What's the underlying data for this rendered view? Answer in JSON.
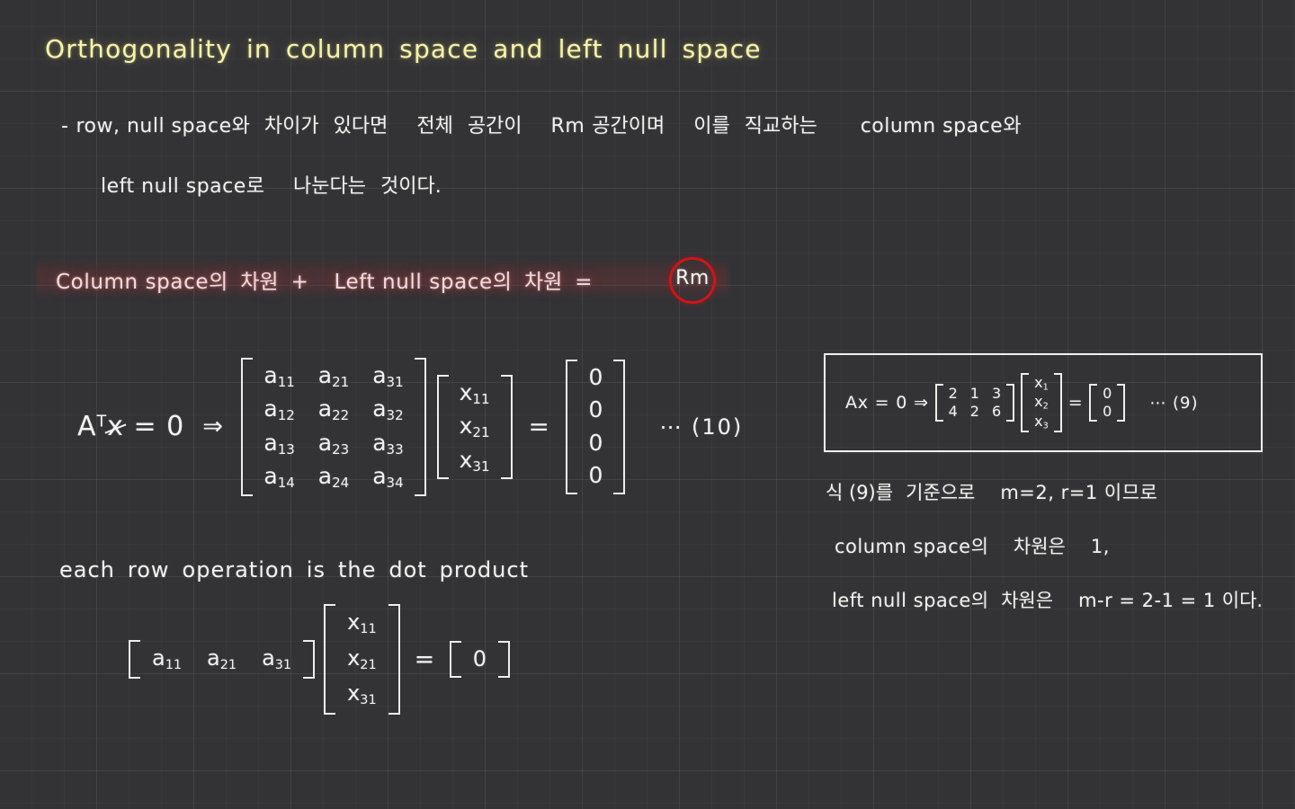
{
  "page": {
    "background_color": "#333336",
    "grid_color": "#3d3d41"
  },
  "title": {
    "words": [
      "Orthogonality",
      "in",
      "column",
      "space",
      "and",
      "left",
      "null",
      "space"
    ],
    "color": "#f7f3a8"
  },
  "paragraph": {
    "line1": {
      "bullet": "-",
      "seg1": "row, null space",
      "seg2": "와",
      "seg3": "차이가",
      "seg4": "있다면",
      "seg5": "전체",
      "seg6": "공간이",
      "seg7": "Rm",
      "seg8": "공간이며",
      "seg9": "이를",
      "seg10": "직교하는",
      "seg11": "column space",
      "seg12": "와"
    },
    "line2": {
      "seg1": "left null space",
      "seg2": "로",
      "seg3": "나눈다는",
      "seg4": "것이다."
    }
  },
  "key_formula": {
    "part1": "Column space",
    "part2": "의",
    "part3": "차원",
    "plus": "+",
    "part4": "Left null space",
    "part5": "의",
    "part6": "차원",
    "equals": "=",
    "circled": "Rm",
    "text_color": "#f6dadc",
    "circle_color": "#cf1417"
  },
  "equation_10": {
    "lhs_A": "A",
    "lhs_T": "T",
    "lhs_x": "x",
    "lhs_eq": "= 0",
    "arrow": "⇒",
    "matrix_A": {
      "rows": [
        [
          "a11",
          "a21",
          "a31"
        ],
        [
          "a12",
          "a22",
          "a32"
        ],
        [
          "a13",
          "a23",
          "a33"
        ],
        [
          "a14",
          "a24",
          "a34"
        ]
      ]
    },
    "vector_x": [
      "x11",
      "x21",
      "x31"
    ],
    "eq_sign": "=",
    "vector_zero": [
      "0",
      "0",
      "0",
      "0"
    ],
    "tag": "⋯ (10)"
  },
  "equation_9_box": {
    "lead": "Ax = 0",
    "arrow": "⇒",
    "matrix": {
      "rows": [
        [
          "2",
          "1",
          "3"
        ],
        [
          "4",
          "2",
          "6"
        ]
      ]
    },
    "vector_x": [
      "x1",
      "x2",
      "x3"
    ],
    "eq_sign": "=",
    "vector_zero": [
      "0",
      "0"
    ],
    "tag": "⋯ (9)"
  },
  "right_notes": {
    "line1": {
      "seg1": "식 (9)를",
      "seg2": "기준으로",
      "seg3": "m=2, r=1 이므로"
    },
    "line2": {
      "seg1": "column space",
      "seg2": "의",
      "seg3": "차원은",
      "seg4": "1,"
    },
    "line3": {
      "seg1": "left null space",
      "seg2": "의",
      "seg3": "차원은",
      "seg4": "m-r = 2-1 = 1",
      "seg5": "이다."
    }
  },
  "dot_product": {
    "caption_words": [
      "each",
      "row",
      "operation",
      "is",
      "the",
      "dot",
      "product"
    ],
    "row_vector": [
      "a11",
      "a21",
      "a31"
    ],
    "col_vector": [
      "x11",
      "x21",
      "x31"
    ],
    "eq_sign": "=",
    "result": "0"
  }
}
